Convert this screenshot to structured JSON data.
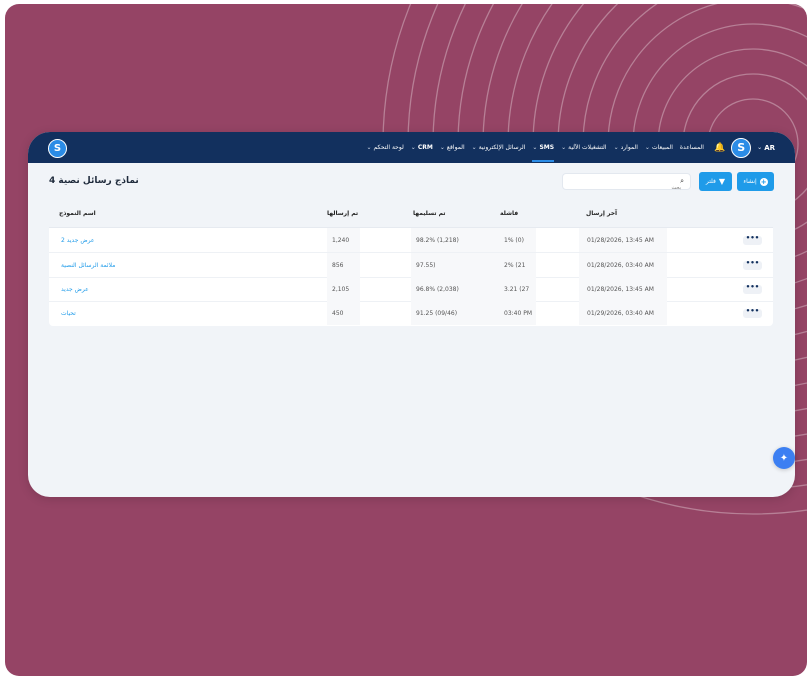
{
  "header": {
    "lang": "AR",
    "nav": [
      "المساعدة",
      "المبيعات",
      "الموارد",
      "التشغيلات الآلية",
      "SMS",
      "الرسائل الإلكترونية",
      "المواقع",
      "CRM",
      "لوحة التحكم"
    ],
    "active_nav_index": 4
  },
  "page": {
    "title": "نماذج رسائل نصية 4",
    "create_label": "إنشاء",
    "filter_label": "فلتر",
    "search_placeholder": "بحث"
  },
  "table": {
    "headers": {
      "name": "اسم النموذج",
      "sent": "تم إرسالها",
      "delivered": "تم تسليمها",
      "failed": "فاشلة",
      "last_sent": "آخر إرسال"
    },
    "rows": [
      {
        "name": "عرض جديد 2",
        "sent": "1,240",
        "delivered": "98.2% (1,218)",
        "failed": "1% (0)",
        "last_sent": "01/28/2026, 13:45 AM"
      },
      {
        "name": "ملائمة الرسائل النصية",
        "sent": "856",
        "delivered": "97.55)",
        "failed": "2% (21",
        "last_sent": "01/28/2026, 03:40 AM"
      },
      {
        "name": "عرض جديد",
        "sent": "2,105",
        "delivered": "96.8% (2,038)",
        "failed": "3.21 (27",
        "last_sent": "01/28/2026, 13:45 AM"
      },
      {
        "name": "تحيات",
        "sent": "450",
        "delivered": "91.25 (09/46)",
        "failed": "03:40 PM",
        "last_sent": "01/29/2026, 03:40 AM"
      }
    ],
    "actions_label": "•••"
  },
  "colors": {
    "background": "#954465",
    "topbar": "#12305e",
    "accent": "#1f9be9",
    "panel": "#f1f4f8"
  }
}
